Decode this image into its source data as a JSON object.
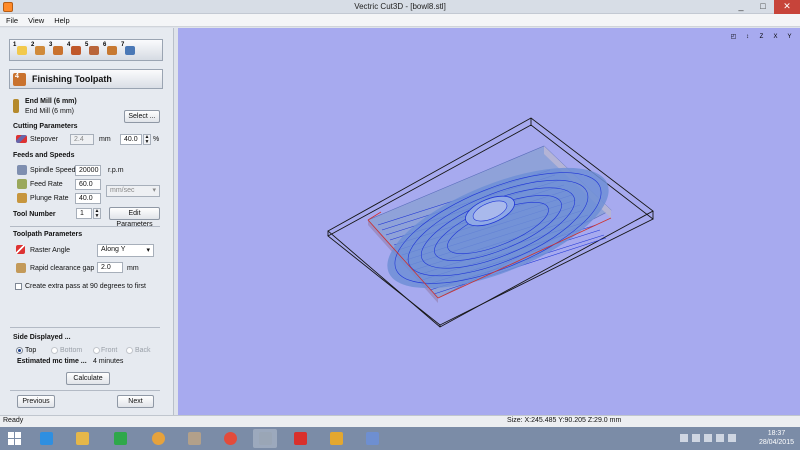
{
  "window": {
    "title": "Vectric Cut3D - [bowl8.stl]",
    "controls": [
      "_",
      "□",
      "✕"
    ]
  },
  "menu": [
    "File",
    "View",
    "Help"
  ],
  "steps": [
    {
      "num": "1",
      "color": "#f2c94c"
    },
    {
      "num": "2",
      "color": "#d08a3a"
    },
    {
      "num": "3",
      "color": "#c9722e"
    },
    {
      "num": "4",
      "color": "#c0582b"
    },
    {
      "num": "5",
      "color": "#b9653a"
    },
    {
      "num": "6",
      "color": "#c77932"
    },
    {
      "num": "7",
      "color": "#4a78b6"
    }
  ],
  "panel": {
    "header_num": "4",
    "header": "Finishing Toolpath",
    "tool_name": "End Mill (6 mm)",
    "tool_sub": "End Mill (6 mm)",
    "select_btn": "Select ...",
    "cutting_params": "Cutting Parameters",
    "stepover_label": "Stepover",
    "stepover_value": "2.4",
    "stepover_unit": "mm",
    "stepover_pct": "40.0",
    "pct_unit": "%",
    "feeds_speeds": "Feeds and Speeds",
    "spindle_label": "Spindle Speed",
    "spindle_value": "20000",
    "spindle_unit": "r.p.m",
    "feed_label": "Feed Rate",
    "feed_value": "60.0",
    "rate_unit": "mm/sec",
    "plunge_label": "Plunge Rate",
    "plunge_value": "40.0",
    "tool_number_label": "Tool Number",
    "tool_number_value": "1",
    "edit_params_btn": "Edit Parameters",
    "toolpath_params": "Toolpath Parameters",
    "raster_label": "Raster Angle",
    "raster_value": "Along Y",
    "clearance_label": "Rapid clearance gap",
    "clearance_value": "2.0",
    "clearance_unit": "mm",
    "extra_pass_label": "Create extra pass at 90 degrees to first",
    "side_displayed": "Side Displayed ...",
    "side_options": [
      "Top",
      "Bottom",
      "Front",
      "Back"
    ],
    "est_label": "Estimated mc time ...",
    "est_value": "4 minutes",
    "calculate_btn": "Calculate",
    "previous_btn": "Previous",
    "next_btn": "Next"
  },
  "viewtools": [
    "◰",
    "↕",
    "Z",
    "X",
    "Y"
  ],
  "status": {
    "left": "Ready",
    "right": "Size: X:245.485 Y:90.205 Z:29.0 mm"
  },
  "taskbar": {
    "time": "18:37",
    "date": "28/04/2015",
    "apps": [
      {
        "name": "ie",
        "color": "#2f8fe0"
      },
      {
        "name": "explorer",
        "color": "#e5b74a"
      },
      {
        "name": "store",
        "color": "#2fa84a"
      },
      {
        "name": "app-b",
        "color": "#e6a23c"
      },
      {
        "name": "app-c",
        "color": "#b2a08a"
      },
      {
        "name": "chrome",
        "color": "#e34b3b"
      },
      {
        "name": "cut3d",
        "color": "#9aa6b6"
      },
      {
        "name": "solidworks",
        "color": "#d9302c"
      },
      {
        "name": "slides",
        "color": "#e3a72f"
      },
      {
        "name": "paint",
        "color": "#6e8fd1"
      }
    ]
  },
  "colors": {
    "viewport_bg": "#a7aaef",
    "toolpath": "#1f35d6",
    "model": "#7e9ed8",
    "box": "#151515",
    "accent_red": "#d1302b"
  }
}
